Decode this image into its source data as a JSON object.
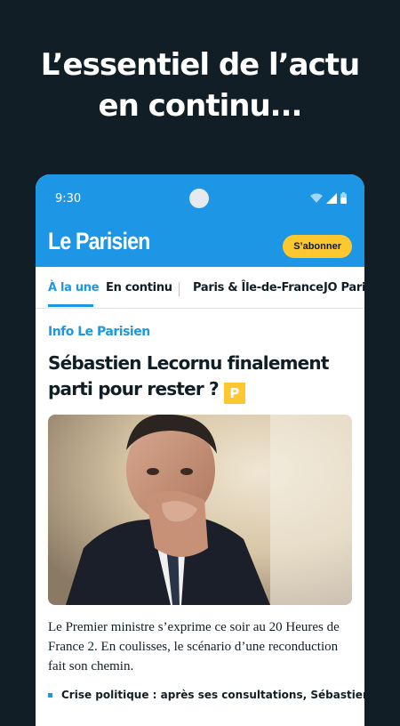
{
  "promo": {
    "line1": "L’essentiel de l’actu",
    "line2": "en continu..."
  },
  "status_bar": {
    "time": "9:30"
  },
  "app": {
    "logo": "Le Parisien",
    "subscribe_label": "S’abonner",
    "brand_color": "#1e96e6",
    "accent_color": "#fdc82f"
  },
  "tabs": [
    {
      "label": "À la une",
      "active": true
    },
    {
      "label": "En continu",
      "active": false
    },
    {
      "label": "Paris & Île-de-France",
      "active": false
    },
    {
      "label": "JO Paris",
      "active": false
    }
  ],
  "article": {
    "kicker": "Info Le Parisien",
    "title": "Sébastien Lecornu finalement parti pour rester ?",
    "premium_badge": "P",
    "lede": "Le Premier ministre s’exprime ce soir au 20 Heures de France 2. En coulisses, le scénario d’une reconduction fait son chemin.",
    "related": "Crise politique : après ses consultations, Sébastien"
  }
}
